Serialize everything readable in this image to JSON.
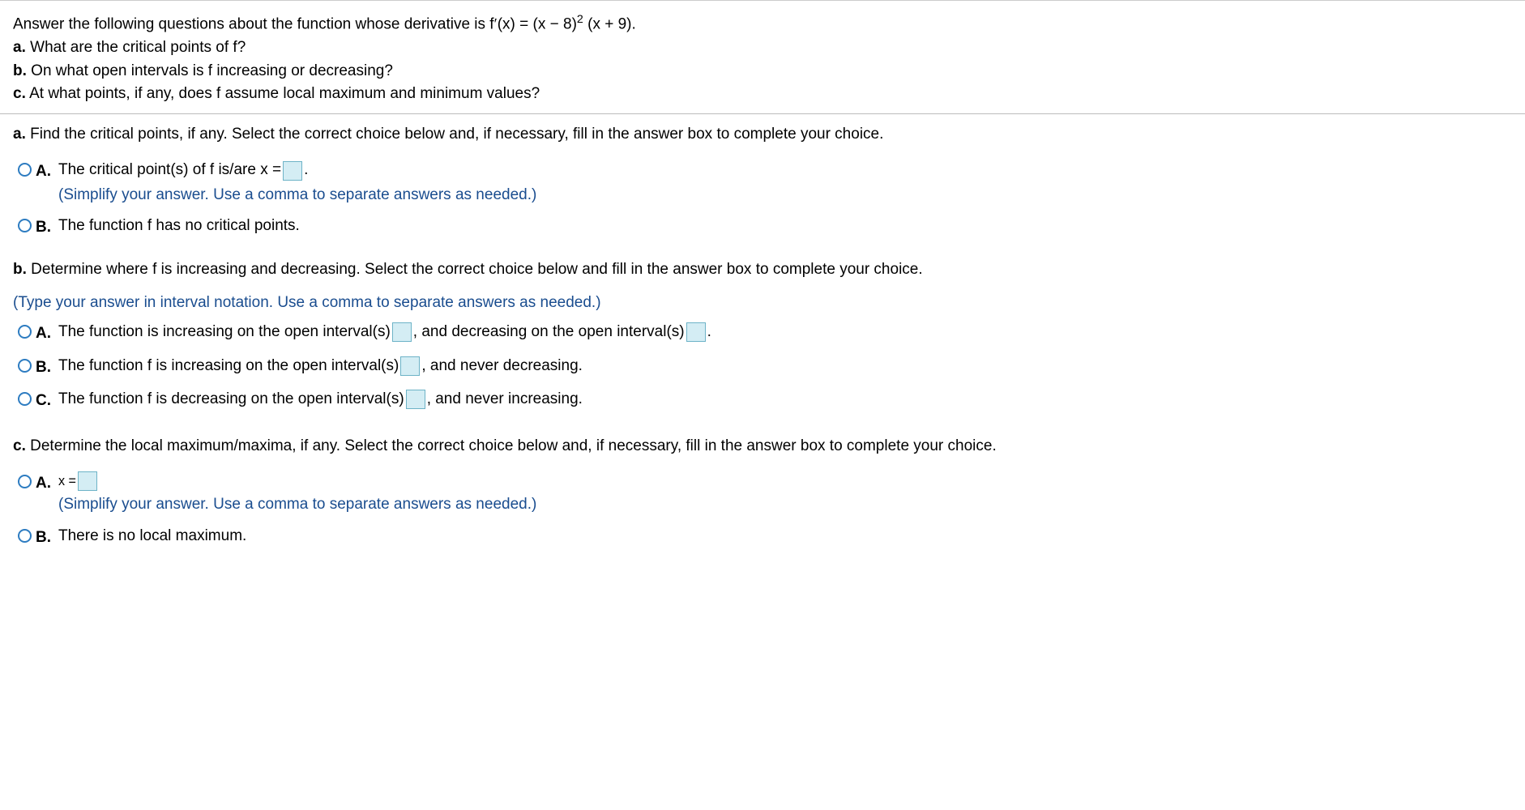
{
  "header": {
    "main_prefix": "Answer the following questions about the function whose derivative is f",
    "main_suffix": "(x) = (x − 8)",
    "main_tail": " (x + 9).",
    "exponent": "2",
    "sub_a_label": "a.",
    "sub_a_text": " What are the critical points of f?",
    "sub_b_label": "b.",
    "sub_b_text": " On what open intervals is f increasing or decreasing?",
    "sub_c_label": "c.",
    "sub_c_text": " At what points, if any, does f assume local maximum and minimum values?"
  },
  "part_a": {
    "label": "a.",
    "prompt": " Find the critical points, if any. Select the correct choice below and, if necessary, fill in the answer box to complete your choice.",
    "options": [
      {
        "letter": "A.",
        "text_before": "The critical point(s) of f is/are x = ",
        "text_after": " .",
        "hint": "(Simplify your answer. Use a comma to separate answers as needed.)",
        "has_box": true
      },
      {
        "letter": "B.",
        "text_before": "The function f has no critical points.",
        "text_after": "",
        "has_box": false
      }
    ]
  },
  "part_b": {
    "label": "b.",
    "prompt": " Determine where f is increasing and decreasing. Select the correct choice below and fill in the answer box to complete your choice.",
    "hint": "(Type your answer in interval notation. Use a comma to separate answers as needed.)",
    "options": [
      {
        "letter": "A.",
        "seg1": "The function is increasing on the open interval(s) ",
        "seg2": " , and decreasing on the open interval(s) ",
        "seg3": " .",
        "boxes": 2
      },
      {
        "letter": "B.",
        "seg1": "The function f is increasing on the open interval(s) ",
        "seg2": " , and never decreasing.",
        "boxes": 1
      },
      {
        "letter": "C.",
        "seg1": "The function f is decreasing on the open interval(s) ",
        "seg2": " , and never increasing.",
        "boxes": 1
      }
    ]
  },
  "part_c": {
    "label": "c.",
    "prompt": " Determine the local maximum/maxima, if any. Select the correct choice below and, if necessary, fill in the answer box to complete your choice.",
    "options": [
      {
        "letter": "A.",
        "text_before": "x = ",
        "text_after": "",
        "hint": "(Simplify your answer. Use a comma to separate answers as needed.)",
        "has_box": true,
        "small_prefix": true
      },
      {
        "letter": "B.",
        "text_before": "There is no local maximum.",
        "text_after": "",
        "has_box": false
      }
    ]
  }
}
